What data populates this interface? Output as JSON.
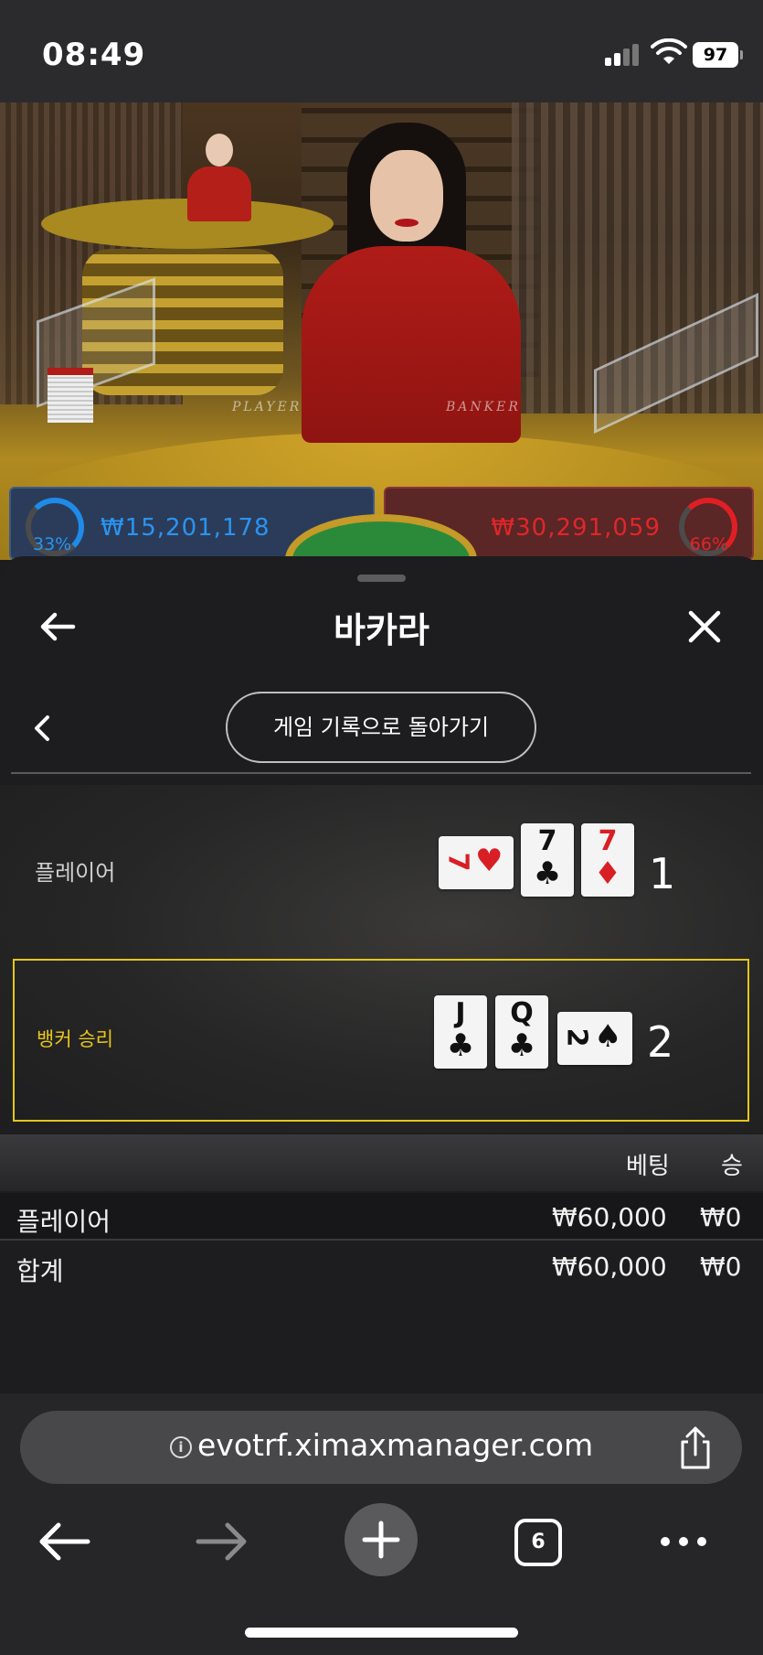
{
  "status_bar": {
    "time": "08:49",
    "battery": "97"
  },
  "video": {
    "table_text_left": "PLAYER",
    "table_text_right": "BANKER",
    "player_bets": {
      "percent": "33%",
      "amount": "₩15,201,178",
      "percent_value": 33
    },
    "banker_bets": {
      "percent": "66%",
      "amount": "₩30,291,059",
      "percent_value": 66
    }
  },
  "sheet": {
    "title": "바카라",
    "history_button": "게임 기록으로 돌아가기",
    "player_row": {
      "label": "플레이어",
      "score": "1",
      "cards": [
        {
          "rank": "7",
          "suit": "♥",
          "color": "red",
          "orientation": "sideways"
        },
        {
          "rank": "7",
          "suit": "♣",
          "color": "black",
          "orientation": "upright"
        },
        {
          "rank": "7",
          "suit": "♦",
          "color": "red",
          "orientation": "upright"
        }
      ]
    },
    "banker_row": {
      "label": "뱅커 승리",
      "score": "2",
      "highlight_color": "#e3c619",
      "cards": [
        {
          "rank": "J",
          "suit": "♣",
          "color": "black",
          "orientation": "upright"
        },
        {
          "rank": "Q",
          "suit": "♣",
          "color": "black",
          "orientation": "upright"
        },
        {
          "rank": "2",
          "suit": "♠",
          "color": "black",
          "orientation": "sideways"
        }
      ]
    },
    "table": {
      "headers": {
        "bet": "베팅",
        "win": "승"
      },
      "rows": [
        {
          "label": "플레이어",
          "bet": "₩60,000",
          "win": "₩0"
        },
        {
          "label": "합계",
          "bet": "₩60,000",
          "win": "₩0"
        }
      ]
    }
  },
  "browser": {
    "url": "evotrf.ximaxmanager.com",
    "tab_count": "6",
    "icons": {
      "back": "arrow-left-icon",
      "forward": "arrow-right-icon",
      "new_tab": "plus-icon",
      "tabs": "tabs-icon",
      "more": "more-dots-icon",
      "share": "share-icon",
      "info": "info-icon"
    }
  },
  "colors": {
    "player_blue": "#2a94f0",
    "banker_red": "#e0262a",
    "win_highlight": "#e3c619"
  }
}
